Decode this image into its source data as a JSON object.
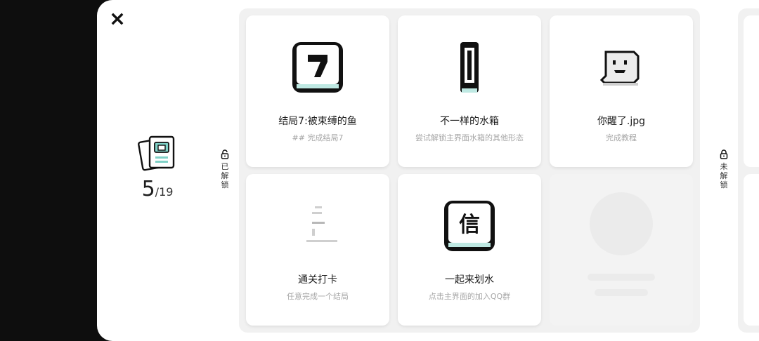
{
  "progress": {
    "unlocked": "5",
    "total": "/19"
  },
  "tabs": {
    "unlocked": [
      "已",
      "解",
      "锁"
    ],
    "locked": [
      "未",
      "解",
      "锁"
    ]
  },
  "cards": [
    {
      "icon": "number-7-icon",
      "title": "结局7:被束缚的鱼",
      "desc": "## 完成结局7"
    },
    {
      "icon": "water-tank-icon",
      "title": "不一样的水箱",
      "desc": "尝试解锁主界面水箱的其他形态"
    },
    {
      "icon": "ghost-face-icon",
      "title": "你醒了.jpg",
      "desc": "完成教程"
    },
    {
      "icon": "faded-glyph-icon",
      "title": "通关打卡",
      "desc": "任意完成一个结局"
    },
    {
      "icon": "letter-xin-icon",
      "title": "一起来划水",
      "desc": "点击主界面的加入QQ群",
      "glyph": "信"
    }
  ],
  "colors": {
    "accent_teal": "#7fd1c7",
    "ink": "#111111",
    "muted": "#a6a6a6"
  }
}
